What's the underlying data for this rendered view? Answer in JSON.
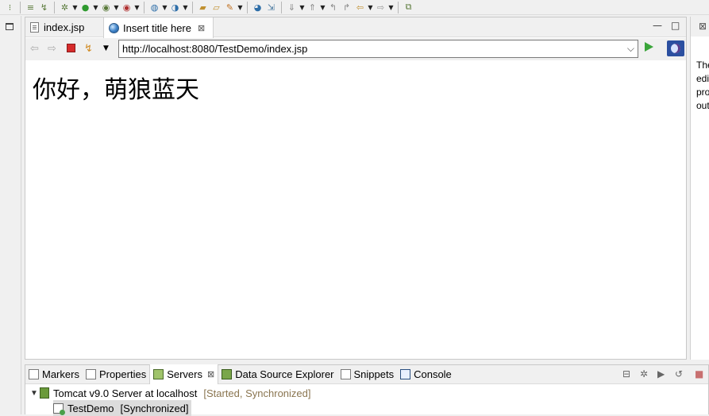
{
  "toolbar": {
    "icons": [
      "quick-access-icon",
      "task-list-icon",
      "debug-icon",
      "run-icon",
      "run-coverage-icon",
      "external-tools-icon",
      "new-server-icon",
      "new-web-icon",
      "open-type-icon",
      "open-folder-icon",
      "search-icon",
      "globe-icon",
      "web-browser-icon",
      "next-annotation-icon",
      "prev-annotation-icon",
      "last-edit-icon",
      "back-icon",
      "forward-icon",
      "pin-editor-icon"
    ]
  },
  "editor": {
    "tabs": [
      {
        "label": "index.jsp",
        "active": false
      },
      {
        "label": "Insert title here",
        "active": true,
        "close": "⊠"
      }
    ],
    "window_controls": {
      "minimize": "—",
      "maximize": "□"
    }
  },
  "browser": {
    "url": "http://localhost:8080/TestDemo/index.jsp",
    "content_heading": "你好，萌狼蓝天"
  },
  "right_panel": {
    "lines": [
      "The",
      "edi",
      "pro",
      "out"
    ],
    "close": "⊠"
  },
  "bottom": {
    "tabs": [
      {
        "label": "Markers",
        "icon": "markers-icon"
      },
      {
        "label": "Properties",
        "icon": "properties-icon"
      },
      {
        "label": "Servers",
        "icon": "servers-icon",
        "active": true,
        "close": "⊠"
      },
      {
        "label": "Data Source Explorer",
        "icon": "data-source-icon"
      },
      {
        "label": "Snippets",
        "icon": "snippets-icon"
      },
      {
        "label": "Console",
        "icon": "console-icon"
      }
    ],
    "server": {
      "name": "Tomcat v9.0 Server at localhost",
      "status": "[Started, Synchronized]"
    },
    "module": {
      "name": "TestDemo",
      "status": "[Synchronized]"
    }
  }
}
